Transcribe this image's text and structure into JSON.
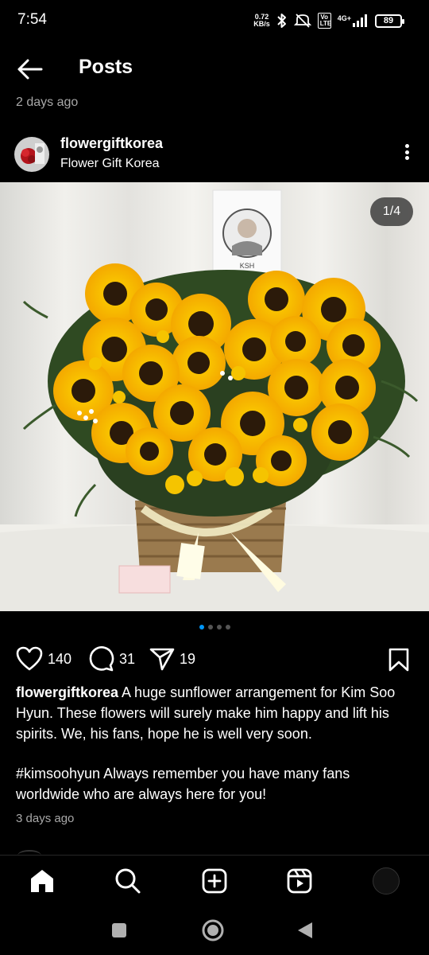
{
  "status": {
    "time": "7:54",
    "net_speed_value": "0.72",
    "net_speed_unit": "KB/s",
    "net_label": "4G+",
    "volte": "Vo LTE",
    "battery": "89"
  },
  "header": {
    "title": "Posts"
  },
  "top_post": {
    "age": "2 days ago"
  },
  "post": {
    "username": "flowergiftkorea",
    "display_name": "Flower Gift Korea",
    "image_counter": "1/4",
    "carousel_total": 4,
    "carousel_active": 1,
    "likes": "140",
    "comments": "31",
    "shares": "19",
    "caption_user": "flowergiftkorea",
    "caption_text": "A huge sunflower arrangement for Kim Soo Hyun. These flowers will surely make him happy and lift his spirits. We, his fans, hope he is well very soon.",
    "hashtag": "#kimsoohyun",
    "caption_text_2": "Always remember you have many fans worldwide who are always here for you!",
    "date": "3 days ago"
  },
  "colors": {
    "background": "#000000",
    "text": "#ffffff",
    "secondary_text": "#a8a8a8",
    "accent": "#0095f6"
  },
  "icons": {
    "back": "arrow-left-icon",
    "more": "more-vertical-icon",
    "like": "heart-icon",
    "comment": "comment-icon",
    "share": "send-icon",
    "save": "bookmark-icon",
    "home": "home-icon",
    "search": "search-icon",
    "create": "plus-square-icon",
    "reels": "reels-icon"
  }
}
